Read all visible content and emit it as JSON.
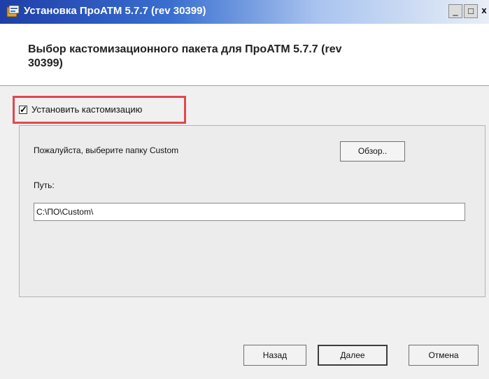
{
  "window": {
    "title": "Установка ПроATM 5.7.7 (rev 30399)",
    "controls": [
      "_",
      "□",
      "x"
    ]
  },
  "header": {
    "title": "Выбор кастомизационного пакета для ПроATM 5.7.7 (rev 30399)"
  },
  "install": {
    "checked": true,
    "check_glyph": "✓",
    "label": "Установить кастомизацию"
  },
  "group": {
    "prompt": "Пожалуйста, выберите папку Custom",
    "browse_label": "Обзор..",
    "path_label": "Путь:",
    "path_value": "C:\\ПО\\Custom\\"
  },
  "footer": {
    "back_label": "Назад",
    "next_label": "Далее",
    "cancel_label": "Отмена"
  },
  "colors": {
    "highlight": "#e0484d",
    "titlebar": "#1e3ea8"
  }
}
